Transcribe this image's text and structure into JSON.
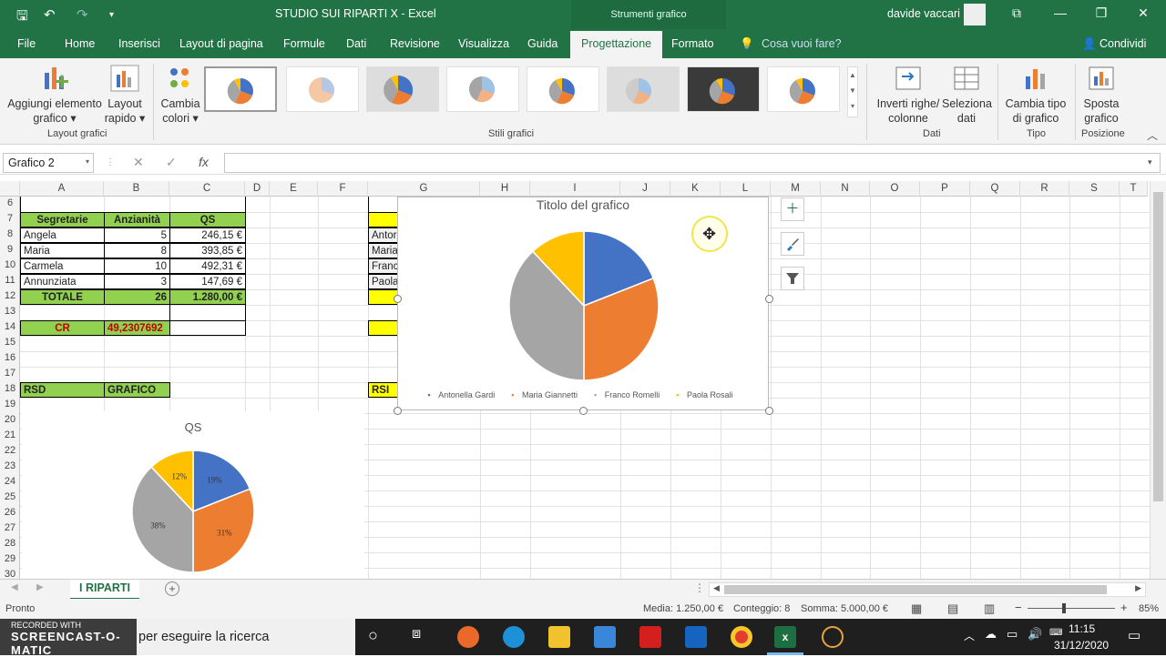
{
  "titlebar": {
    "title": "STUDIO SUI RIPARTI X  -  Excel",
    "tools": "Strumenti grafico",
    "user": "davide vaccari"
  },
  "tabs": [
    "File",
    "Home",
    "Inserisci",
    "Layout di pagina",
    "Formule",
    "Dati",
    "Revisione",
    "Visualizza",
    "Guida",
    "Progettazione",
    "Formato",
    "Cosa vuoi fare?",
    "Condividi"
  ],
  "ribbon": {
    "add_element": "Aggiungi elemento",
    "add_element2": "grafico",
    "quick_layout": "Layout",
    "quick_layout2": "rapido",
    "group_layout": "Layout grafici",
    "colors": "Cambia",
    "colors2": "colori",
    "group_styles": "Stili grafici",
    "switch": "Inverti righe/",
    "switch2": "colonne",
    "select_data": "Seleziona",
    "select_data2": "dati",
    "group_data": "Dati",
    "change_type": "Cambia tipo",
    "change_type2": "di grafico",
    "group_type": "Tipo",
    "move": "Sposta",
    "move2": "grafico",
    "group_pos": "Posizione"
  },
  "formula": {
    "namebox": "Grafico 2",
    "fx": "fx",
    "cancel": "✕",
    "enter": "✓"
  },
  "columns": [
    "A",
    "B",
    "C",
    "D",
    "E",
    "F",
    "G",
    "H",
    "I",
    "J",
    "K",
    "L",
    "M",
    "N",
    "O",
    "P",
    "Q",
    "R",
    "S",
    "T"
  ],
  "rows": [
    "6",
    "7",
    "8",
    "9",
    "10",
    "11",
    "12",
    "13",
    "14",
    "15",
    "16",
    "17",
    "18",
    "19",
    "20",
    "21",
    "22",
    "23",
    "24",
    "25",
    "26",
    "27",
    "28",
    "29",
    "30"
  ],
  "table": {
    "headers": [
      "Segretarie",
      "Anzianità",
      "QS"
    ],
    "rows": [
      [
        "Angela",
        "5",
        "246,15 €"
      ],
      [
        "Maria",
        "8",
        "393,85 €"
      ],
      [
        "Carmela",
        "10",
        "492,31 €"
      ],
      [
        "Annunziata",
        "3",
        "147,69 €"
      ]
    ],
    "total": [
      "TOTALE",
      "26",
      "1.280,00 €"
    ],
    "cr_label": "CR",
    "cr_value": "49,2307692",
    "rsd": "RSD",
    "grafico": "GRAFICO",
    "rsi": "RSI",
    "g_names": [
      "Antor",
      "Maria",
      "Franc",
      "Paola"
    ]
  },
  "chart1": {
    "title": "Titolo del grafico",
    "legend": [
      "Antonella Gardi",
      "Maria Giannetti",
      "Franco Romelli",
      "Paola Rosali"
    ]
  },
  "chart2": {
    "title": "QS",
    "labels": [
      "19%",
      "31%",
      "38%",
      "12%"
    ]
  },
  "chart_data": [
    {
      "type": "pie",
      "title": "Titolo del grafico",
      "categories": [
        "Antonella Gardi",
        "Maria Giannetti",
        "Franco Romelli",
        "Paola Rosali"
      ],
      "values": [
        19,
        31,
        38,
        12
      ],
      "colors": [
        "#4472c4",
        "#ed7d31",
        "#a5a5a5",
        "#ffc000"
      ]
    },
    {
      "type": "pie",
      "title": "QS",
      "categories": [
        "Angela",
        "Maria",
        "Carmela",
        "Annunziata"
      ],
      "values": [
        19,
        31,
        38,
        12
      ],
      "colors": [
        "#4472c4",
        "#ed7d31",
        "#a5a5a5",
        "#ffc000"
      ]
    }
  ],
  "sheet": {
    "tab": "I RIPARTI",
    "add": "+"
  },
  "status": {
    "ready": "Pronto",
    "avg": "Media: 1.250,00 €",
    "count": "Conteggio: 8",
    "sum": "Somma: 5.000,00 €",
    "zoom": "85%"
  },
  "taskbar": {
    "search": "per eseguire la ricerca",
    "recorded": "RECORDED WITH",
    "time": "11:15",
    "date": "31/12/2020"
  }
}
